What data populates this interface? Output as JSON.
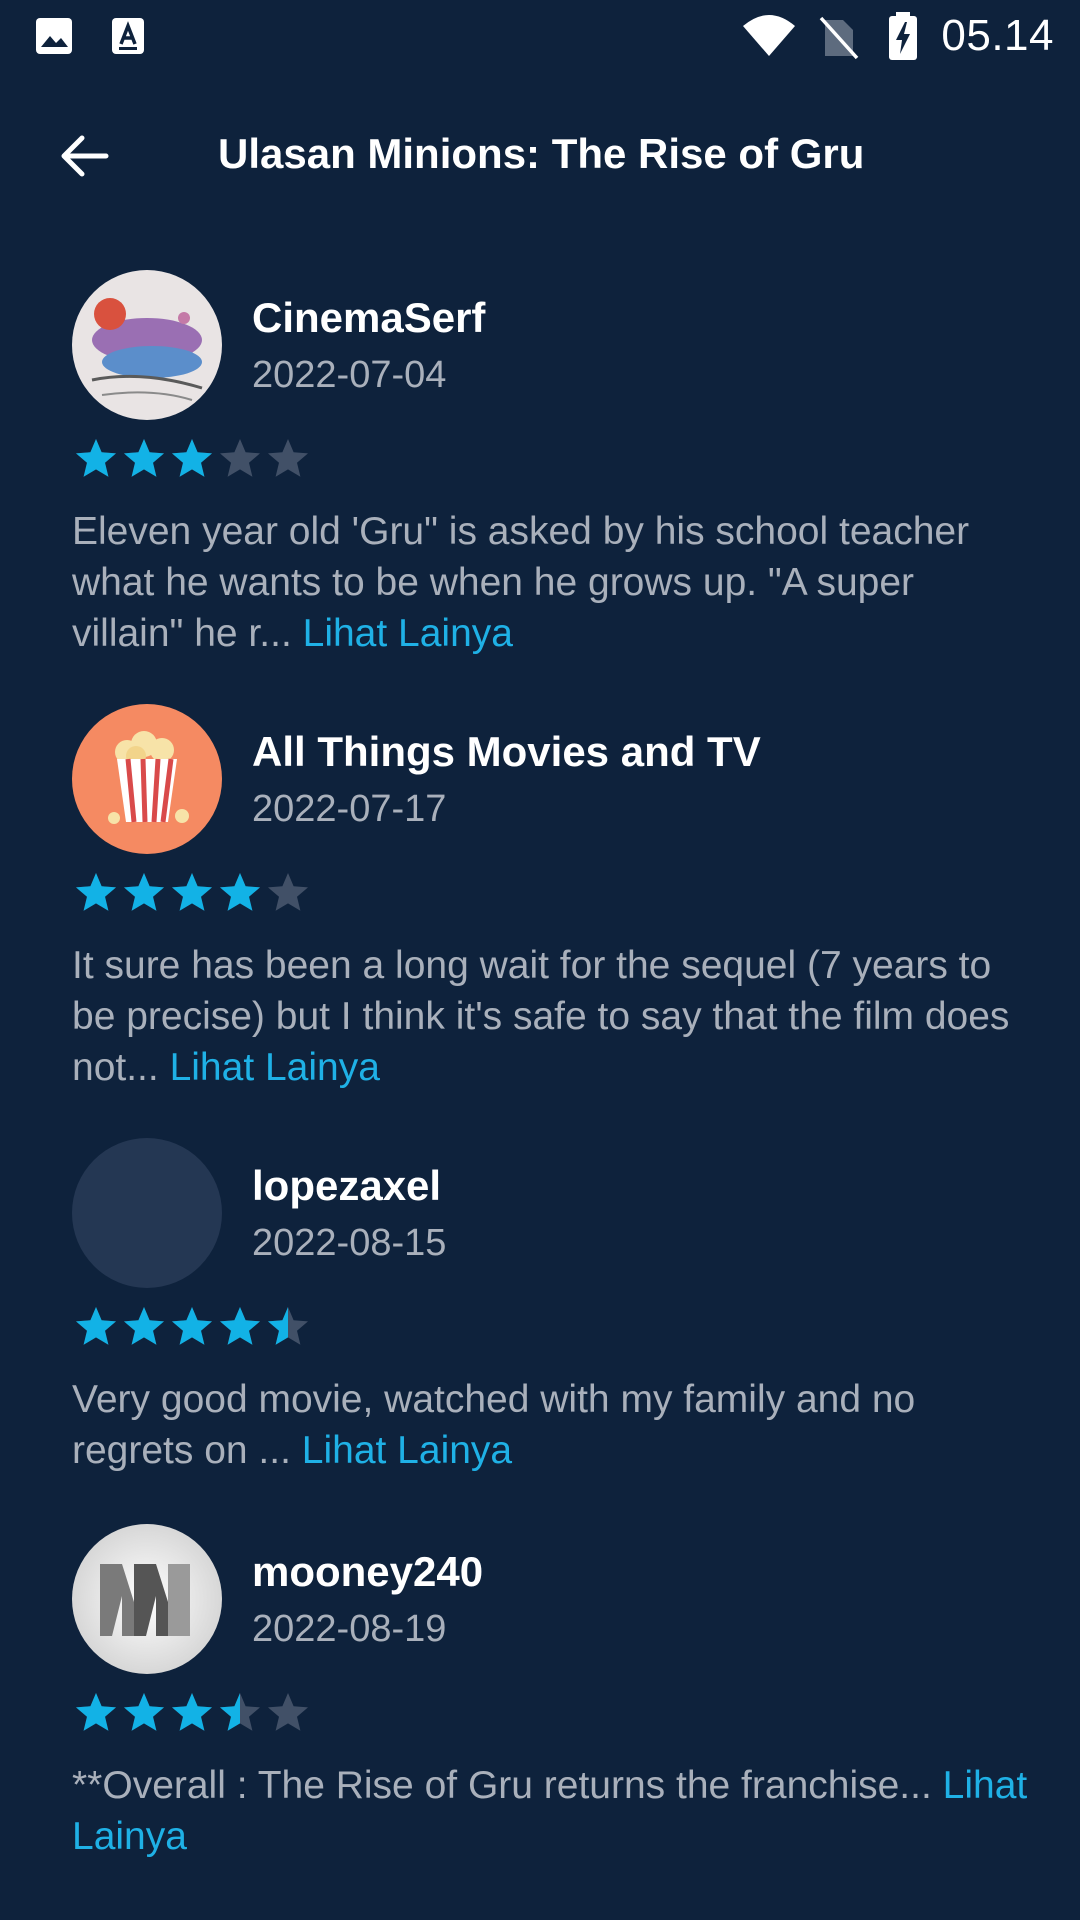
{
  "status_bar": {
    "time": "05.14",
    "left_icons": [
      "image-icon",
      "text-a-icon"
    ],
    "right_icons": [
      "wifi-icon",
      "no-sim-icon",
      "battery-charging-icon"
    ]
  },
  "app_bar": {
    "back_icon": "arrow-left-icon",
    "title": "Ulasan Minions: The Rise of Gru"
  },
  "colors": {
    "background": "#0e223c",
    "star_active": "#12b2e6",
    "star_inactive": "#415067",
    "link": "#1fb1e6",
    "secondary_text": "#a9b0bb"
  },
  "reviews": [
    {
      "author": "CinemaSerf",
      "date": "2022-07-04",
      "rating": 3,
      "max_rating": 5,
      "text": "Eleven year old 'Gru\" is asked by his school teacher what he wants to be when he grows up. \"A super villain\" he r...",
      "read_more": "Lihat Lainya",
      "avatar": "painting-avatar"
    },
    {
      "author": "All Things Movies and TV",
      "date": "2022-07-17",
      "rating": 4,
      "max_rating": 5,
      "text": "It sure has been a long wait for the sequel (7 years to be precise) but I think it's safe to say that the film does not...",
      "read_more": "Lihat Lainya",
      "avatar": "popcorn-avatar"
    },
    {
      "author": "lopezaxel",
      "date": "2022-08-15",
      "rating": 4.5,
      "max_rating": 5,
      "text": "Very good movie, watched with my family and no regrets on ...",
      "read_more": "Lihat Lainya",
      "avatar": "empty-avatar"
    },
    {
      "author": "mooney240",
      "date": "2022-08-19",
      "rating": 3.5,
      "max_rating": 5,
      "text": "**Overall : The Rise of Gru returns the franchise...",
      "read_more": "Lihat Lainya",
      "avatar": "mm-logo-avatar"
    }
  ]
}
